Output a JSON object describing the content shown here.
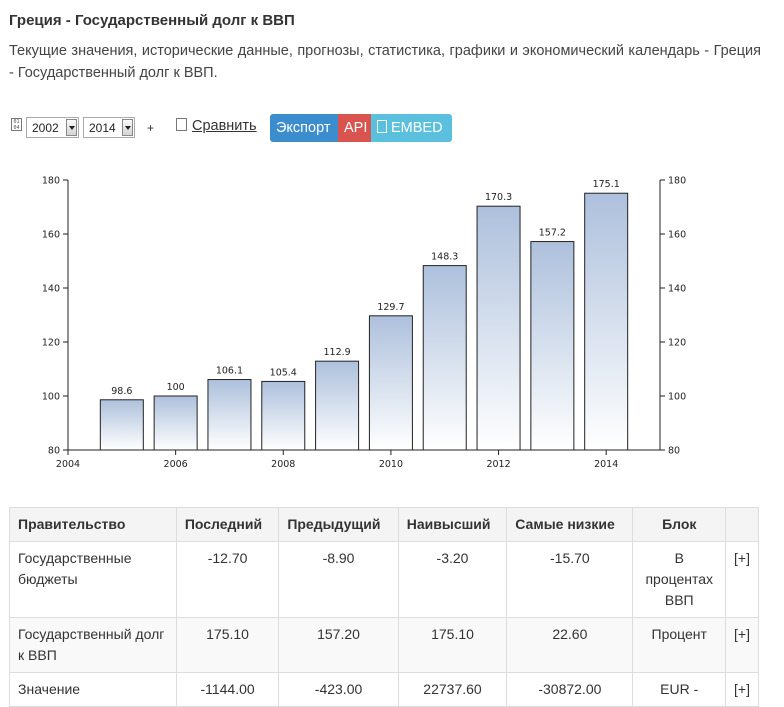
{
  "page": {
    "title": "Греция - Государственный долг к ВВП",
    "description": "Текущие значения, исторические данные, прогнозы, статистика, графики и экономический календарь - Греция - Государственный долг к ВВП."
  },
  "toolbar": {
    "calendar_icon_text": "01 04",
    "start_year": "2002",
    "end_year": "2014",
    "plus": "+",
    "compare_label": "Сравнить",
    "export_label": "Экспорт",
    "api_label": "API",
    "embed_label": "EMBED"
  },
  "colors": {
    "export": "#3c8dcd",
    "api": "#d9534f",
    "embed": "#5bc0de",
    "bar_top": "#adc0dc",
    "bar_bottom": "#ffffff"
  },
  "chart_data": {
    "type": "bar",
    "x": [
      2005,
      2006,
      2007,
      2008,
      2009,
      2010,
      2011,
      2012,
      2013,
      2014
    ],
    "values": [
      98.6,
      100,
      106.1,
      105.4,
      112.9,
      129.7,
      148.3,
      170.3,
      157.2,
      175.1
    ],
    "value_labels": [
      "98.6",
      "100",
      "106.1",
      "105.4",
      "112.9",
      "129.7",
      "148.3",
      "170.3",
      "157.2",
      "175.1"
    ],
    "xlim": [
      2004,
      2015
    ],
    "ylim": [
      80,
      180
    ],
    "x_ticks": [
      "2004",
      "2006",
      "2008",
      "2010",
      "2012",
      "2014"
    ],
    "y_ticks": [
      "80",
      "100",
      "120",
      "140",
      "160",
      "180"
    ],
    "grid": false
  },
  "table": {
    "headers": [
      "Правительство",
      "Последний",
      "Предыдущий",
      "Наивысший",
      "Самые низкие",
      "Блок",
      ""
    ],
    "rows": [
      {
        "name": "Государственные бюджеты",
        "last": "-12.70",
        "previous": "-8.90",
        "highest": "-3.20",
        "lowest": "-15.70",
        "unit": "В процентах ВВП",
        "expand": "[+]"
      },
      {
        "name": "Государственный долг к ВВП",
        "last": "175.10",
        "previous": "157.20",
        "highest": "175.10",
        "lowest": "22.60",
        "unit": "Процент",
        "expand": "[+]"
      },
      {
        "name": "Значение",
        "last": "-1144.00",
        "previous": "-423.00",
        "highest": "22737.60",
        "lowest": "-30872.00",
        "unit": "EUR -",
        "expand": "[+]"
      }
    ]
  }
}
